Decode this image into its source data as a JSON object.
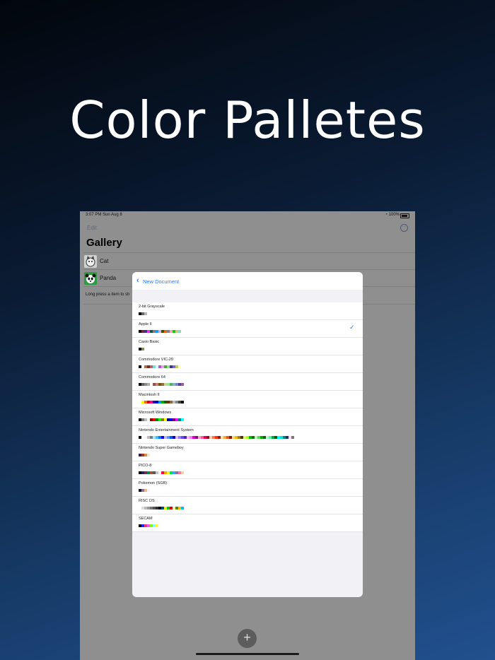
{
  "headline": "Color Palletes",
  "status": {
    "time_date": "3:07 PM   Sun Aug 8",
    "battery": "100%"
  },
  "nav": {
    "edit": "Edit",
    "more_icon": "ellipsis-circle-icon"
  },
  "gallery": {
    "title": "Gallery",
    "items": [
      {
        "name": "Cat",
        "thumb": "cat-thumbnail",
        "color": "#d0d0d0"
      },
      {
        "name": "Panda",
        "thumb": "panda-thumbnail",
        "color": "#2f9a44"
      }
    ],
    "hint": "Long press a item to sh"
  },
  "fab": {
    "icon": "plus-icon",
    "label": "+"
  },
  "sheet": {
    "back_label": "New Document",
    "selected": "Apple II",
    "palettes": [
      {
        "name": "2-bit Grayscale",
        "colors": [
          "#000000",
          "#676767",
          "#b6b6b6",
          "#ffffff"
        ]
      },
      {
        "name": "Apple II",
        "colors": [
          "#000000",
          "#722640",
          "#40337f",
          "#e434fe",
          "#0e5940",
          "#808080",
          "#1b9afe",
          "#bfb3ff",
          "#404c00",
          "#e46501",
          "#808080",
          "#f1a6bf",
          "#1bcb01",
          "#bfcc80",
          "#8dd9bf",
          "#ffffff"
        ]
      },
      {
        "name": "Casio Basic",
        "colors": [
          "#000000",
          "#7f8e5c",
          "#ffffff"
        ]
      },
      {
        "name": "Commodore VIC-20",
        "colors": [
          "#000000",
          "#ffffff",
          "#a8734a",
          "#772d26",
          "#b66862",
          "#85d4dc",
          "#c5ffff",
          "#a85fb4",
          "#e99df5",
          "#559e4a",
          "#92df87",
          "#42348b",
          "#7e70ca",
          "#bdcc71",
          "#ffffb0",
          "#ffffff"
        ]
      },
      {
        "name": "Commodore 64",
        "colors": [
          "#000000",
          "#626262",
          "#898989",
          "#adadad",
          "#ffffff",
          "#9f4e44",
          "#cb7e75",
          "#6d5412",
          "#a1683c",
          "#c9d487",
          "#9ae29b",
          "#5cab5e",
          "#6abfc6",
          "#887ecb",
          "#50459b",
          "#a057a3"
        ]
      },
      {
        "name": "Macintosh II",
        "colors": [
          "#ffffff",
          "#ffff00",
          "#ff6500",
          "#dc0000",
          "#ff0097",
          "#360097",
          "#0000ca",
          "#0097ff",
          "#00a800",
          "#006500",
          "#653600",
          "#976536",
          "#b9b9b9",
          "#868686",
          "#454545",
          "#000000"
        ]
      },
      {
        "name": "Microsoft Windows",
        "colors": [
          "#000000",
          "#7e7e7e",
          "#bebebe",
          "#ffffff",
          "#7e0000",
          "#fe0000",
          "#047e00",
          "#06ff04",
          "#7e7e00",
          "#ffff04",
          "#00007e",
          "#0000ff",
          "#7e007e",
          "#fe00ff",
          "#047e7e",
          "#06ffff"
        ]
      },
      {
        "name": "Nintendo Entertainment System",
        "colors": [
          "#000000",
          "#fcfcfc",
          "#f8f8f8",
          "#bcbcbc",
          "#7c7c7c",
          "#a4e4fc",
          "#3cbcfc",
          "#0078f8",
          "#0000fc",
          "#b8b8f8",
          "#6888fc",
          "#0058f8",
          "#0000bc",
          "#d8b8f8",
          "#9878f8",
          "#6844fc",
          "#4428bc",
          "#f8b8f8",
          "#f878f8",
          "#d800cc",
          "#940084",
          "#f8a4c0",
          "#f85898",
          "#e40058",
          "#a80020",
          "#f0d0b0",
          "#f87858",
          "#f83800",
          "#a81000",
          "#fce0a8",
          "#fca044",
          "#e45c10",
          "#881400",
          "#f8d878",
          "#f8b800",
          "#ac7c00",
          "#503000",
          "#d8f878",
          "#b8f818",
          "#00b800",
          "#007800",
          "#b8f8b8",
          "#58d854",
          "#00a800",
          "#006800",
          "#b8f8d8",
          "#58f898",
          "#00a844",
          "#005800",
          "#00fcfc",
          "#00e8d8",
          "#008888",
          "#004058",
          "#f8d8f8",
          "#787878"
        ]
      },
      {
        "name": "Nintendo Super Gameboy",
        "colors": [
          "#331e50",
          "#a63725",
          "#d68e49",
          "#f7e7c6"
        ]
      },
      {
        "name": "PICO-8",
        "colors": [
          "#000000",
          "#1d2b53",
          "#7e2553",
          "#008751",
          "#ab5236",
          "#5f574f",
          "#c2c3c7",
          "#fff1e8",
          "#ff004d",
          "#ffa300",
          "#ffec27",
          "#00e436",
          "#29adff",
          "#83769c",
          "#ff77a8",
          "#ffccaa"
        ]
      },
      {
        "name": "Pokemon (SGB)",
        "colors": [
          "#181010",
          "#84739c",
          "#f7b58c",
          "#ffefff"
        ]
      },
      {
        "name": "RISC OS",
        "colors": [
          "#ffffff",
          "#dddddd",
          "#bbbbbb",
          "#999999",
          "#777777",
          "#555555",
          "#333333",
          "#000000",
          "#004499",
          "#eeee00",
          "#00cc00",
          "#dd0000",
          "#eeeebb",
          "#558800",
          "#ffbb00",
          "#00bbff"
        ]
      },
      {
        "name": "SECAM",
        "colors": [
          "#000000",
          "#2121ff",
          "#f03c79",
          "#ff50ff",
          "#7fff00",
          "#7fffff",
          "#ffff3f",
          "#ffffff"
        ]
      }
    ]
  }
}
